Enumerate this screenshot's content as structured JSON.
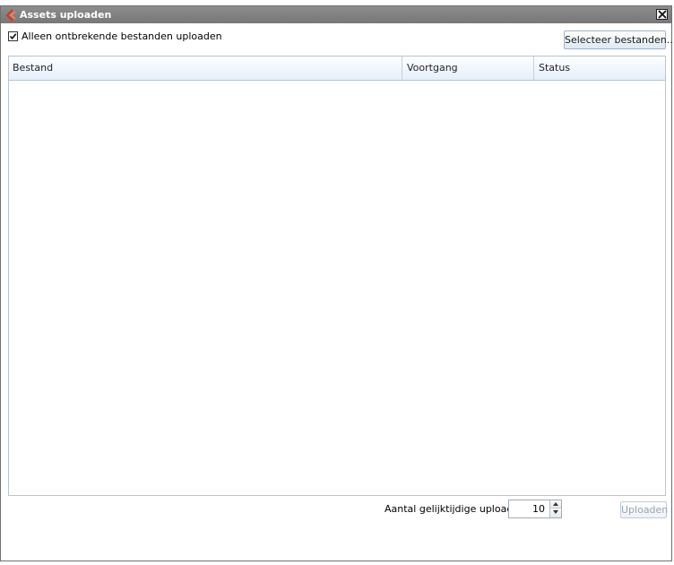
{
  "window": {
    "title": "Assets uploaden",
    "icon": "app-logo-icon",
    "close_icon": "close-icon"
  },
  "options": {
    "missing_only_label": "Alleen ontbrekende bestanden uploaden",
    "missing_only_checked": true,
    "select_files_label": "Selecteer bestanden..."
  },
  "grid": {
    "columns": [
      "Bestand",
      "Voortgang",
      "Status"
    ],
    "rows": []
  },
  "footer": {
    "concurrent_label": "Aantal gelijktijdige uploads:",
    "concurrent_value": "10",
    "upload_label": "Uploaden",
    "upload_enabled": false
  },
  "colors": {
    "titlebar": "#808080",
    "header_gradient_end": "#e6effa",
    "disabled_text": "#98a4b4"
  }
}
